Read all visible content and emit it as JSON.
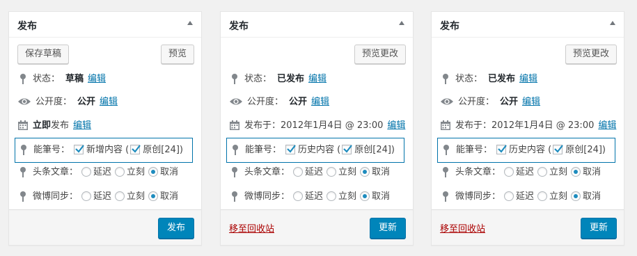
{
  "colors": {
    "link": "#0073aa",
    "primary": "#0085ba",
    "trash": "#aa0000",
    "box_border": "#0073aa"
  },
  "icons": {
    "pin": "pin-icon",
    "eye": "eye-icon",
    "calendar": "calendar-icon",
    "collapse": "collapse-arrow-icon",
    "check": "checkmark-icon"
  },
  "panels": [
    {
      "title": "发布",
      "save_draft_label": "保存草稿",
      "preview_label": "预览",
      "status_label": "状态：",
      "status_value": "草稿",
      "status_edit": "编辑",
      "visibility_label": "公开度：",
      "visibility_value": "公开",
      "visibility_edit": "编辑",
      "publish_strong": "立即",
      "publish_rest": "发布",
      "publish_edit": "编辑",
      "pen_label": "能筆号：",
      "pen_option_1": "新增内容",
      "paren_open": "(",
      "pen_option_2": "原创[24])",
      "headline_label": "头条文章：",
      "weibo_label": "微博同步：",
      "opt_delay": "延迟",
      "opt_now": "立刻",
      "opt_cancel": "取消",
      "primary_label": "发布"
    },
    {
      "title": "发布",
      "preview_label": "预览更改",
      "status_label": "状态：",
      "status_value": "已发布",
      "status_edit": "编辑",
      "visibility_label": "公开度：",
      "visibility_value": "公开",
      "visibility_edit": "编辑",
      "published_on": "发布于：2012年1月4日 @ 23:00",
      "publish_edit": "编辑",
      "pen_label": "能筆号：",
      "pen_option_1": "历史内容",
      "paren_open": "(",
      "pen_option_2": "原创[24])",
      "headline_label": "头条文章：",
      "weibo_label": "微博同步：",
      "opt_delay": "延迟",
      "opt_now": "立刻",
      "opt_cancel": "取消",
      "trash_label": "移至回收站",
      "primary_label": "更新"
    },
    {
      "title": "发布",
      "preview_label": "预览更改",
      "status_label": "状态：",
      "status_value": "已发布",
      "status_edit": "编辑",
      "visibility_label": "公开度：",
      "visibility_value": "公开",
      "visibility_edit": "编辑",
      "published_on": "发布于：2012年1月4日 @ 23:00",
      "publish_edit": "编辑",
      "pen_label": "能筆号：",
      "pen_option_1": "历史内容",
      "paren_open": "(",
      "pen_option_2": "原创[24])",
      "headline_label": "头条文章：",
      "weibo_label": "微博同步：",
      "opt_delay": "延迟",
      "opt_now": "立刻",
      "opt_cancel": "取消",
      "trash_label": "移至回收站",
      "primary_label": "更新"
    }
  ]
}
